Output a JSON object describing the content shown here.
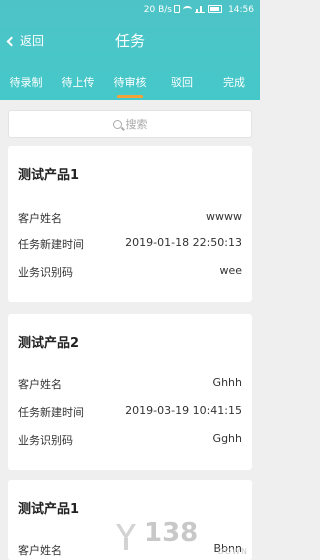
{
  "status_bar": {
    "speed": "20 B/s",
    "time": "14:56",
    "icons": [
      "vibrate-icon",
      "wifi-icon",
      "signal-icon",
      "battery-icon"
    ]
  },
  "header": {
    "back_label": "返回",
    "title": "任务"
  },
  "tabs": [
    {
      "label": "待录制",
      "active": false
    },
    {
      "label": "待上传",
      "active": false
    },
    {
      "label": "待审核",
      "active": true
    },
    {
      "label": "驳回",
      "active": false
    },
    {
      "label": "完成",
      "active": false
    }
  ],
  "search": {
    "placeholder": "搜索"
  },
  "cards": [
    {
      "title": "测试产品1",
      "fields": [
        {
          "label": "客户姓名",
          "value": "wwww"
        },
        {
          "label": "任务新建时间",
          "value": "2019-01-18 22:50:13"
        },
        {
          "label": "业务识别码",
          "value": "wee"
        }
      ]
    },
    {
      "title": "测试产品2",
      "fields": [
        {
          "label": "客户姓名",
          "value": "Ghhh"
        },
        {
          "label": "任务新建时间",
          "value": "2019-03-19 10:41:15"
        },
        {
          "label": "业务识别码",
          "value": "Gghh"
        }
      ]
    },
    {
      "title": "测试产品1",
      "fields": [
        {
          "label": "客户姓名",
          "value": "Bbnn"
        }
      ]
    }
  ],
  "watermark": {
    "text": "138",
    "sub": "DOWN"
  },
  "colors": {
    "header": "#45c8c9",
    "tab_indicator": "#f2a33a",
    "background": "#efefef"
  }
}
